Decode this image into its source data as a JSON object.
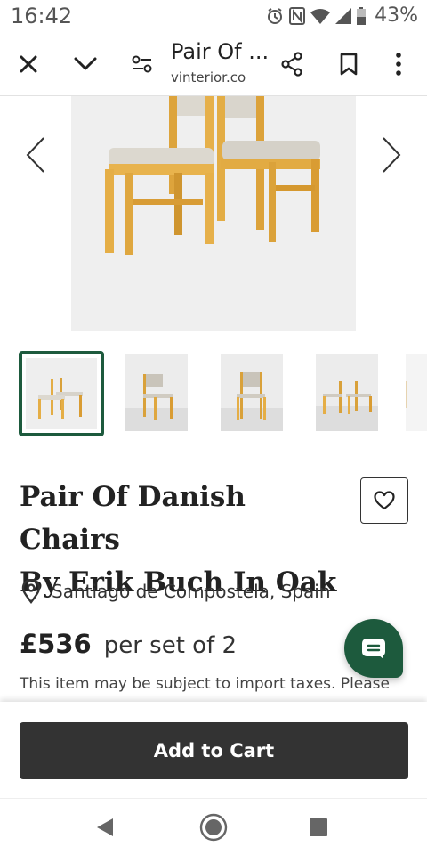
{
  "status_bar": {
    "time": "16:42",
    "battery_percent": "43%",
    "icons": [
      "alarm-icon",
      "nfc-icon",
      "wifi-icon",
      "signal-icon",
      "battery-icon"
    ]
  },
  "toolbar": {
    "title": "Pair Of ...",
    "url": "vinterior.co",
    "icons": [
      "close-icon",
      "chevron-down-icon",
      "site-settings-icon",
      "share-icon",
      "bookmark-icon",
      "more-vert-icon"
    ]
  },
  "gallery": {
    "image_alt": "Pair Of Danish Chairs By Erik Buch In Oak",
    "thumbnail_count": 5,
    "selected_thumbnail": 1
  },
  "product": {
    "title_line1": "Pair Of Danish Chairs",
    "title_line2": "By Erik Buch In Oak",
    "location": "Santiago de Compostela, Spain",
    "price": "£536",
    "price_unit": "per set of 2",
    "taxes_note": "This item may be subject to import taxes. Please"
  },
  "actions": {
    "add_to_cart": "Add to Cart"
  },
  "colors": {
    "brand_green": "#1d5a3d",
    "cart_button": "#333333",
    "oak": "#e0a93e"
  }
}
